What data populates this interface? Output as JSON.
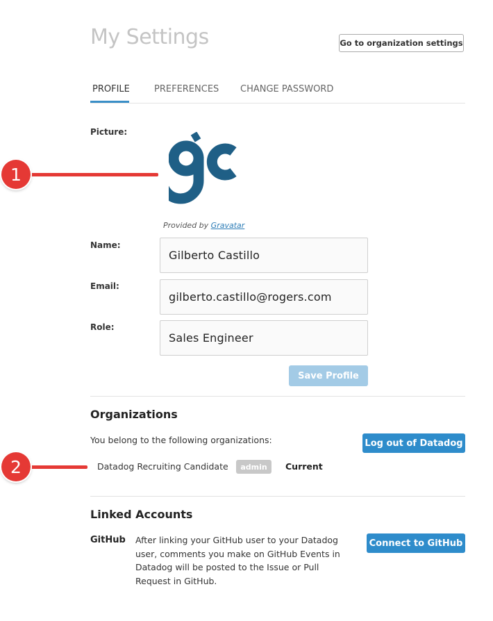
{
  "header": {
    "title": "My Settings",
    "org_settings_button": "Go to organization settings"
  },
  "tabs": [
    {
      "label": "PROFILE",
      "active": true
    },
    {
      "label": "PREFERENCES",
      "active": false
    },
    {
      "label": "CHANGE PASSWORD",
      "active": false
    }
  ],
  "profile": {
    "picture_label": "Picture:",
    "provided_by_prefix": "Provided by ",
    "provided_by_link": "Gravatar",
    "name_label": "Name:",
    "name_value": "Gilberto Castillo",
    "email_label": "Email:",
    "email_value": "gilberto.castillo@rogers.com",
    "role_label": "Role:",
    "role_value": "Sales Engineer",
    "save_button": "Save Profile"
  },
  "organizations": {
    "title": "Organizations",
    "intro": "You belong to the following organizations:",
    "logout_button": "Log out of Datadog",
    "items": [
      {
        "name": "Datadog Recruiting Candidate",
        "badge": "admin",
        "status": "Current"
      }
    ]
  },
  "linked_accounts": {
    "title": "Linked Accounts",
    "github_label": "GitHub",
    "github_description": "After linking your GitHub user to your Datadog user, comments you make on GitHub Events in Datadog will be posted to the Issue or Pull Request in GitHub.",
    "connect_button": "Connect to GitHub"
  },
  "annotations": [
    {
      "number": "1"
    },
    {
      "number": "2"
    }
  ],
  "colors": {
    "accent": "#2e8ccb",
    "disabled_button": "#a3cbe6",
    "annotation_red": "#e53935",
    "avatar_blue": "#1f5f86"
  }
}
